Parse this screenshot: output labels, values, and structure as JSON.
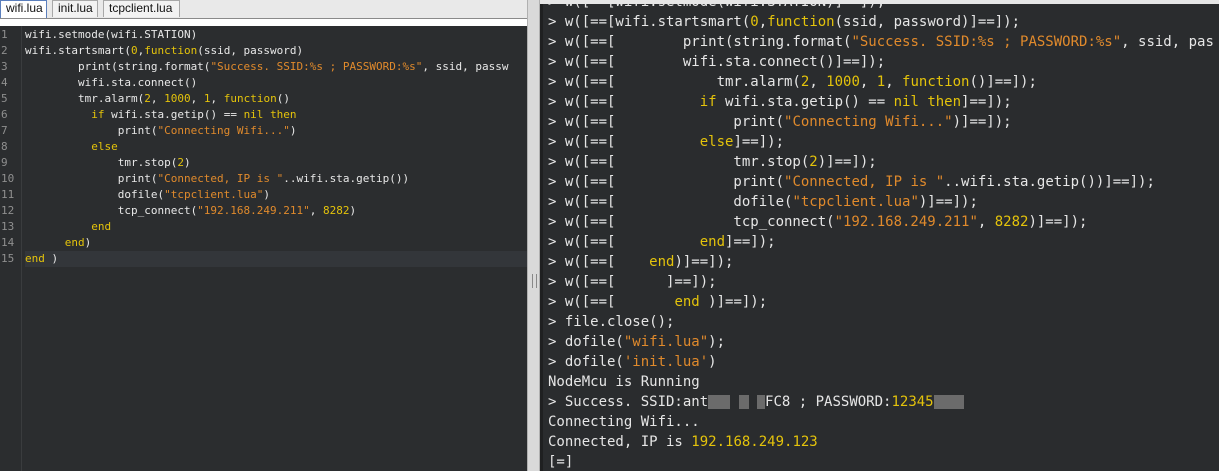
{
  "editor": {
    "tabs": [
      {
        "label": "wifi.lua",
        "active": true
      },
      {
        "label": "init.lua",
        "active": false
      },
      {
        "label": "tcpclient.lua",
        "active": false
      }
    ],
    "line_numbers": [
      "1",
      "2",
      "3",
      "4",
      "5",
      "6",
      "7",
      "8",
      "9",
      "10",
      "11",
      "12",
      "13",
      "14",
      "15"
    ],
    "lines": [
      [
        {
          "t": "wifi.setmode(wifi.STATION)",
          "c": ""
        }
      ],
      [
        {
          "t": "wifi.startsmart(",
          "c": ""
        },
        {
          "t": "0",
          "c": "num"
        },
        {
          "t": ",",
          "c": ""
        },
        {
          "t": "function",
          "c": "kw"
        },
        {
          "t": "(ssid, password)",
          "c": ""
        }
      ],
      [
        {
          "t": "        print(string.format(",
          "c": ""
        },
        {
          "t": "\"Success. SSID:%s ; PASSWORD:%s\"",
          "c": "str"
        },
        {
          "t": ", ssid, passw",
          "c": ""
        }
      ],
      [
        {
          "t": "        wifi.sta.connect()",
          "c": ""
        }
      ],
      [
        {
          "t": "        tmr.alarm(",
          "c": ""
        },
        {
          "t": "2",
          "c": "num"
        },
        {
          "t": ", ",
          "c": ""
        },
        {
          "t": "1000",
          "c": "num"
        },
        {
          "t": ", ",
          "c": ""
        },
        {
          "t": "1",
          "c": "num"
        },
        {
          "t": ", ",
          "c": ""
        },
        {
          "t": "function",
          "c": "kw"
        },
        {
          "t": "()",
          "c": ""
        }
      ],
      [
        {
          "t": "          ",
          "c": ""
        },
        {
          "t": "if",
          "c": "kw"
        },
        {
          "t": " wifi.sta.getip() == ",
          "c": ""
        },
        {
          "t": "nil",
          "c": "kw"
        },
        {
          "t": " ",
          "c": ""
        },
        {
          "t": "then",
          "c": "kw"
        }
      ],
      [
        {
          "t": "              print(",
          "c": ""
        },
        {
          "t": "\"Connecting Wifi...\"",
          "c": "str"
        },
        {
          "t": ")",
          "c": ""
        }
      ],
      [
        {
          "t": "          ",
          "c": ""
        },
        {
          "t": "else",
          "c": "kw"
        }
      ],
      [
        {
          "t": "              tmr.stop(",
          "c": ""
        },
        {
          "t": "2",
          "c": "num"
        },
        {
          "t": ")",
          "c": ""
        }
      ],
      [
        {
          "t": "              print(",
          "c": ""
        },
        {
          "t": "\"Connected, IP is \"",
          "c": "str"
        },
        {
          "t": "..wifi.sta.getip())",
          "c": ""
        }
      ],
      [
        {
          "t": "              dofile(",
          "c": ""
        },
        {
          "t": "\"tcpclient.lua\"",
          "c": "str"
        },
        {
          "t": ")",
          "c": ""
        }
      ],
      [
        {
          "t": "              tcp_connect(",
          "c": ""
        },
        {
          "t": "\"192.168.249.211\"",
          "c": "str"
        },
        {
          "t": ", ",
          "c": ""
        },
        {
          "t": "8282",
          "c": "num"
        },
        {
          "t": ")",
          "c": ""
        }
      ],
      [
        {
          "t": "          ",
          "c": ""
        },
        {
          "t": "end",
          "c": "kw"
        }
      ],
      [
        {
          "t": "      ",
          "c": ""
        },
        {
          "t": "end",
          "c": "kw"
        },
        {
          "t": ")",
          "c": ""
        }
      ],
      [
        {
          "t": "end",
          "c": "kw"
        },
        {
          "t": " )",
          "c": ""
        }
      ]
    ]
  },
  "console": {
    "lines": [
      [
        {
          "t": "> w([==[wifi.setmode(wifi.STATION)]==]);",
          "c": ""
        }
      ],
      [
        {
          "t": "> w([==[wifi.startsmart(",
          "c": ""
        },
        {
          "t": "0",
          "c": "num"
        },
        {
          "t": ",",
          "c": ""
        },
        {
          "t": "function",
          "c": "kw"
        },
        {
          "t": "(ssid, password)]==]);",
          "c": ""
        }
      ],
      [
        {
          "t": "> w([==[        print(string.format(",
          "c": ""
        },
        {
          "t": "\"Success. SSID:%s ; PASSWORD:%s\"",
          "c": "str"
        },
        {
          "t": ", ssid, pas",
          "c": ""
        }
      ],
      [
        {
          "t": "> w([==[        wifi.sta.connect()]==]);",
          "c": ""
        }
      ],
      [
        {
          "t": "> w([==[            tmr.alarm(",
          "c": ""
        },
        {
          "t": "2",
          "c": "num"
        },
        {
          "t": ", ",
          "c": ""
        },
        {
          "t": "1000",
          "c": "num"
        },
        {
          "t": ", ",
          "c": ""
        },
        {
          "t": "1",
          "c": "num"
        },
        {
          "t": ", ",
          "c": ""
        },
        {
          "t": "function",
          "c": "kw"
        },
        {
          "t": "()]==]);",
          "c": ""
        }
      ],
      [
        {
          "t": "> w([==[          ",
          "c": ""
        },
        {
          "t": "if",
          "c": "kw"
        },
        {
          "t": " wifi.sta.getip() == ",
          "c": ""
        },
        {
          "t": "nil",
          "c": "kw"
        },
        {
          "t": " ",
          "c": ""
        },
        {
          "t": "then",
          "c": "kw"
        },
        {
          "t": "]==]);",
          "c": ""
        }
      ],
      [
        {
          "t": "> w([==[              print(",
          "c": ""
        },
        {
          "t": "\"Connecting Wifi...\"",
          "c": "str"
        },
        {
          "t": ")]==]);",
          "c": ""
        }
      ],
      [
        {
          "t": "> w([==[          ",
          "c": ""
        },
        {
          "t": "else",
          "c": "kw"
        },
        {
          "t": "]==]);",
          "c": ""
        }
      ],
      [
        {
          "t": "> w([==[              tmr.stop(",
          "c": ""
        },
        {
          "t": "2",
          "c": "num"
        },
        {
          "t": ")]==]);",
          "c": ""
        }
      ],
      [
        {
          "t": "> w([==[              print(",
          "c": ""
        },
        {
          "t": "\"Connected, IP is \"",
          "c": "str"
        },
        {
          "t": "..wifi.sta.getip())]==]);",
          "c": ""
        }
      ],
      [
        {
          "t": "> w([==[              dofile(",
          "c": ""
        },
        {
          "t": "\"tcpclient.lua\"",
          "c": "str"
        },
        {
          "t": ")]==]);",
          "c": ""
        }
      ],
      [
        {
          "t": "> w([==[              tcp_connect(",
          "c": ""
        },
        {
          "t": "\"192.168.249.211\"",
          "c": "str"
        },
        {
          "t": ", ",
          "c": ""
        },
        {
          "t": "8282",
          "c": "num"
        },
        {
          "t": ")]==]);",
          "c": ""
        }
      ],
      [
        {
          "t": "> w([==[          ",
          "c": ""
        },
        {
          "t": "end",
          "c": "kw"
        },
        {
          "t": "]==]);",
          "c": ""
        }
      ],
      [
        {
          "t": "> w([==[    ",
          "c": ""
        },
        {
          "t": "end",
          "c": "kw"
        },
        {
          "t": ")]==]);",
          "c": ""
        }
      ],
      [
        {
          "t": "> w([==[      ]==]);",
          "c": ""
        }
      ],
      [
        {
          "t": "> w([==[       ",
          "c": ""
        },
        {
          "t": "end",
          "c": "kw"
        },
        {
          "t": " )]==]);",
          "c": ""
        }
      ],
      [
        {
          "t": "> file.close();",
          "c": ""
        }
      ],
      [
        {
          "t": "> dofile(",
          "c": ""
        },
        {
          "t": "\"wifi.lua\"",
          "c": "str"
        },
        {
          "t": ");",
          "c": ""
        }
      ],
      [
        {
          "t": "> dofile(",
          "c": ""
        },
        {
          "t": "'init.lua'",
          "c": "str"
        },
        {
          "t": ")",
          "c": ""
        }
      ],
      [
        {
          "t": "NodeMcu is Running",
          "c": ""
        }
      ],
      [
        {
          "t": "> Success. SSID:ant",
          "c": ""
        },
        {
          "t": "",
          "c": "blur",
          "w": 22
        },
        {
          "t": " ",
          "c": ""
        },
        {
          "t": "",
          "c": "blur",
          "w": 10
        },
        {
          "t": " ",
          "c": ""
        },
        {
          "t": "",
          "c": "blur",
          "w": 8
        },
        {
          "t": "FC8 ; PASSWORD:",
          "c": ""
        },
        {
          "t": "12345",
          "c": "val"
        },
        {
          "t": "",
          "c": "blur",
          "w": 30
        }
      ],
      [
        {
          "t": "Connecting Wifi...",
          "c": ""
        }
      ],
      [
        {
          "t": "Connected, IP is ",
          "c": ""
        },
        {
          "t": "192.168.249.123",
          "c": "val"
        }
      ],
      [
        {
          "t": "[=]",
          "c": ""
        }
      ]
    ]
  }
}
